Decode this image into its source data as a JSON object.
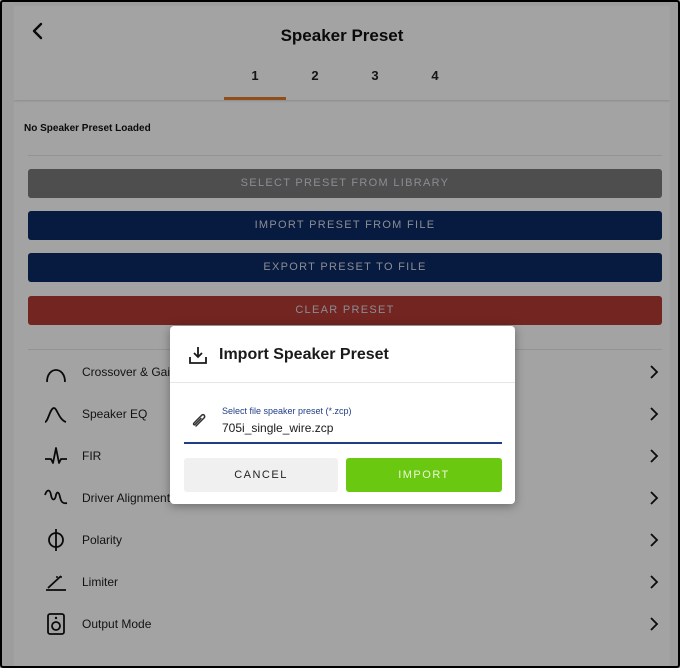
{
  "header": {
    "title": "Speaker Preset",
    "tabs": [
      "1",
      "2",
      "3",
      "4"
    ],
    "active_tab": "1"
  },
  "status": "No Speaker Preset Loaded",
  "actions": [
    {
      "label": "SELECT PRESET FROM LIBRARY",
      "color": "#7a7a7a"
    },
    {
      "label": "IMPORT PRESET FROM FILE",
      "color": "#0c2a63"
    },
    {
      "label": "EXPORT PRESET TO FILE",
      "color": "#0c2a63"
    },
    {
      "label": "CLEAR PRESET",
      "color": "#b53b35"
    }
  ],
  "menu": [
    {
      "label": "Crossover & Gain",
      "icon": "crossover-icon"
    },
    {
      "label": "Speaker EQ",
      "icon": "eq-curve-icon"
    },
    {
      "label": "FIR",
      "icon": "fir-impulse-icon"
    },
    {
      "label": "Driver Alignment",
      "icon": "driver-alignment-icon"
    },
    {
      "label": "Polarity",
      "icon": "polarity-icon"
    },
    {
      "label": "Limiter",
      "icon": "limiter-icon"
    },
    {
      "label": "Output Mode",
      "icon": "output-mode-icon"
    }
  ],
  "dialog": {
    "title": "Import Speaker Preset",
    "field_label": "Select file speaker preset (*.zcp)",
    "field_value": "705i_single_wire.zcp",
    "cancel": "CANCEL",
    "import": "IMPORT"
  },
  "colors": {
    "accent_orange": "#e27a2a",
    "navy": "#0c2a63",
    "green": "#6ac810",
    "red": "#b53b35"
  }
}
